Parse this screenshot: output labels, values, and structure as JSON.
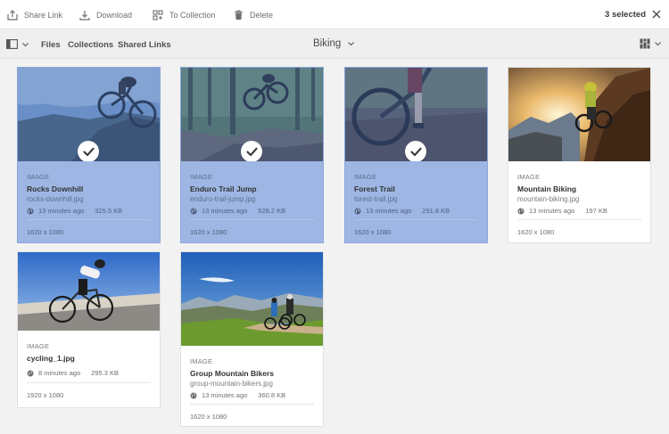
{
  "actionbar": {
    "share_label": "Share Link",
    "download_label": "Download",
    "collection_label": "To Collection",
    "delete_label": "Delete",
    "selected_count": "3 selected"
  },
  "navbar": {
    "files": "Files",
    "collections": "Collections",
    "shared_links": "Shared Links",
    "folder_title": "Biking"
  },
  "assets": [
    {
      "type": "IMAGE",
      "title": "Rocks Downhill",
      "filename": "rocks-downhill.jpg",
      "modified": "13 minutes ago",
      "size": "325.5 KB",
      "dimensions": "1620 x 1080",
      "selected": true
    },
    {
      "type": "IMAGE",
      "title": "Enduro Trail Jump",
      "filename": "enduro-trail-jump.jpg",
      "modified": "13 minutes ago",
      "size": "528.2 KB",
      "dimensions": "1620 x 1080",
      "selected": true
    },
    {
      "type": "IMAGE",
      "title": "Forest Trail",
      "filename": "forest-trail.jpg",
      "modified": "13 minutes ago",
      "size": "291.8 KB",
      "dimensions": "1620 x 1080",
      "selected": true
    },
    {
      "type": "IMAGE",
      "title": "Mountain Biking",
      "filename": "mountain-biking.jpg",
      "modified": "13 minutes ago",
      "size": "197 KB",
      "dimensions": "1620 x 1080",
      "selected": false
    },
    {
      "type": "IMAGE",
      "title": "cycling_1.jpg",
      "filename": "",
      "modified": "8 minutes ago",
      "size": "295.3 KB",
      "dimensions": "1920 x 1080",
      "selected": false
    },
    {
      "type": "IMAGE",
      "title": "Group Mountain Bikers",
      "filename": "group-mountain-bikers.jpg",
      "modified": "13 minutes ago",
      "size": "360.8 KB",
      "dimensions": "1620 x 1080",
      "selected": false
    }
  ],
  "colors": {
    "selected_card": "#9db6e4",
    "accent_blue": "#2c6ed5"
  }
}
